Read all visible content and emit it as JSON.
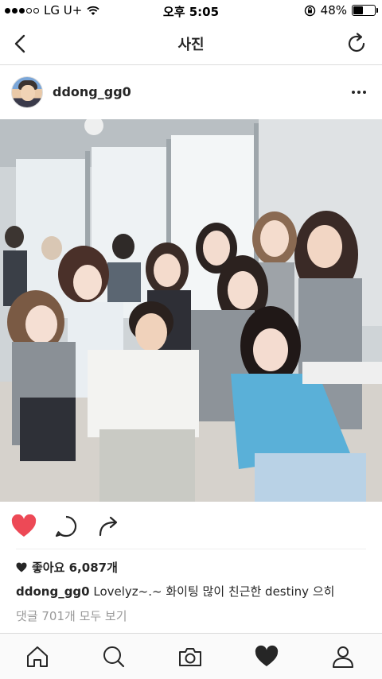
{
  "status_bar": {
    "carrier": "LG U+",
    "time": "오후 5:05",
    "battery": "48%",
    "battery_level": 0.48
  },
  "nav": {
    "title": "사진"
  },
  "post": {
    "username": "ddong_gg0",
    "likes_label": "좋아요 6,087개",
    "caption_user": "ddong_gg0",
    "caption_text": "Lovelyz~.~ 화이팅  많이 친근한 destiny 으히",
    "view_comments": "댓글 701개 모두 보기",
    "liked": true
  },
  "icons": {
    "back": "chevron-left-icon",
    "refresh": "refresh-icon",
    "more": "more-horizontal-icon",
    "like": "heart-icon",
    "comment": "comment-icon",
    "share": "share-icon",
    "home": "home-icon",
    "search": "search-icon",
    "camera": "camera-icon",
    "activity": "heart-icon",
    "profile": "profile-icon"
  },
  "colors": {
    "like_red": "#ed4956",
    "text": "#262626",
    "muted": "#999999"
  }
}
